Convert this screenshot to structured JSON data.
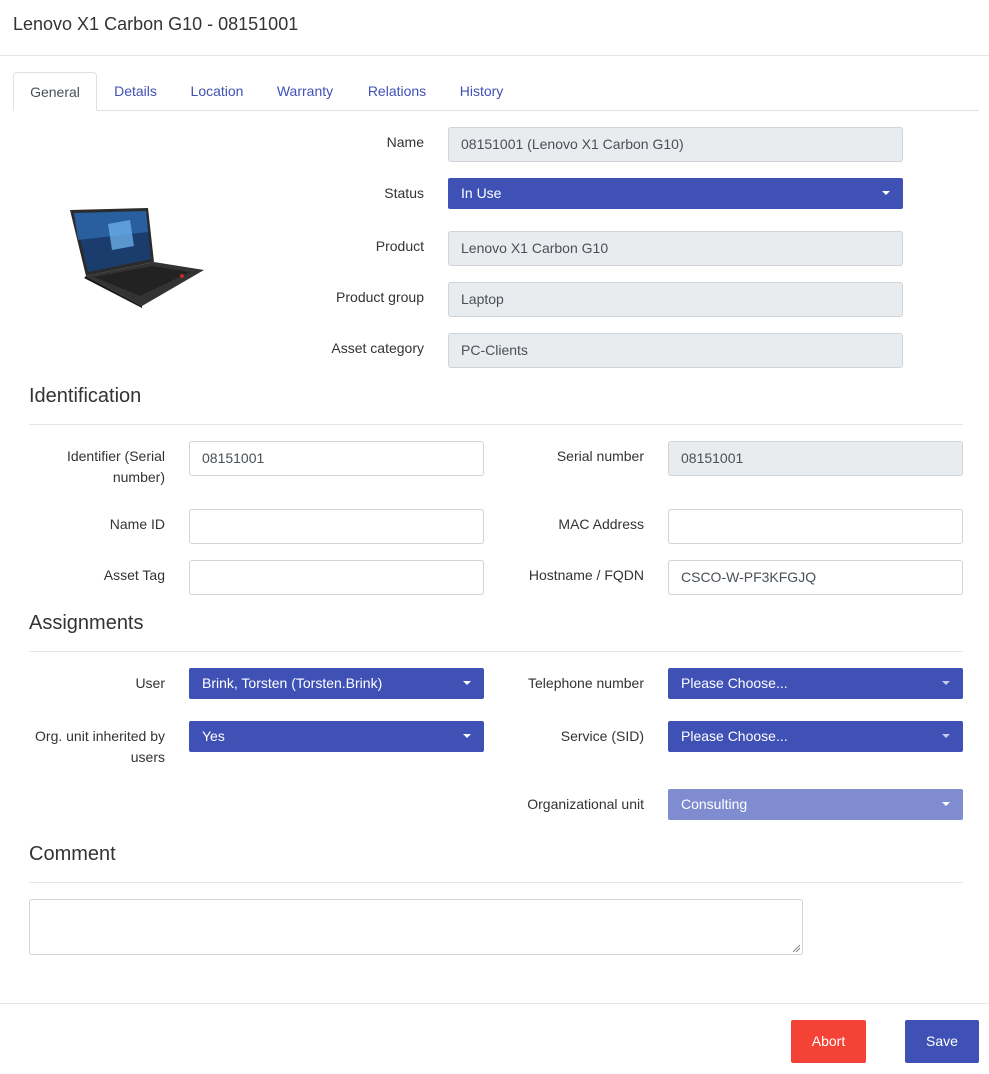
{
  "header": {
    "title": "Lenovo X1 Carbon G10 - 08151001"
  },
  "tabs": [
    {
      "label": "General",
      "active": true
    },
    {
      "label": "Details"
    },
    {
      "label": "Location"
    },
    {
      "label": "Warranty"
    },
    {
      "label": "Relations"
    },
    {
      "label": "History"
    }
  ],
  "general": {
    "image": "laptop-product-image",
    "fields": {
      "name": {
        "label": "Name",
        "value": "08151001 (Lenovo X1 Carbon G10)"
      },
      "status": {
        "label": "Status",
        "value": "In Use"
      },
      "product": {
        "label": "Product",
        "value": "Lenovo X1 Carbon G10"
      },
      "product_group": {
        "label": "Product group",
        "value": "Laptop"
      },
      "asset_category": {
        "label": "Asset category",
        "value": "PC-Clients"
      }
    }
  },
  "identification": {
    "title": "Identification",
    "identifier": {
      "label": "Identifier (Serial number)",
      "value": "08151001"
    },
    "serial_number": {
      "label": "Serial number",
      "value": "08151001"
    },
    "name_id": {
      "label": "Name ID",
      "value": ""
    },
    "mac_address": {
      "label": "MAC Address",
      "value": ""
    },
    "asset_tag": {
      "label": "Asset Tag",
      "value": ""
    },
    "hostname": {
      "label": "Hostname / FQDN",
      "value": "CSCO-W-PF3KFGJQ"
    }
  },
  "assignments": {
    "title": "Assignments",
    "user": {
      "label": "User",
      "value": "Brink, Torsten (Torsten.Brink)"
    },
    "telephone": {
      "label": "Telephone number",
      "value": "Please Choose..."
    },
    "org_inherited": {
      "label": "Org. unit inherited by users",
      "value": "Yes"
    },
    "service": {
      "label": "Service (SID)",
      "value": "Please Choose..."
    },
    "org_unit": {
      "label": "Organizational unit",
      "value": "Consulting"
    }
  },
  "comment": {
    "title": "Comment",
    "value": ""
  },
  "footer": {
    "abort_label": "Abort",
    "save_label": "Save"
  },
  "colors": {
    "primary": "#3f51b5",
    "danger": "#f44336",
    "disabled_select": "#7f8dd0",
    "readonly_bg": "#e9ecef"
  }
}
